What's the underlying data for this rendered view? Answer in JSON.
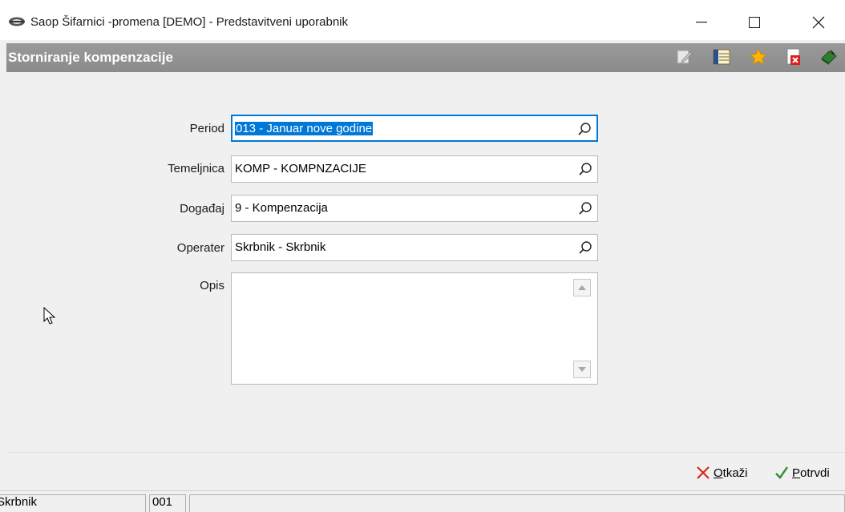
{
  "window": {
    "title": "Saop Šifarnici -promena [DEMO] - Predstavitveni uporabnik"
  },
  "header": {
    "title": "Storniranje kompenzacije",
    "icons": [
      "edit-icon",
      "columns-icon",
      "favorite-star-icon",
      "pdf-close-icon",
      "exit-book-icon"
    ]
  },
  "form": {
    "period": {
      "label": "Period",
      "value": "013 - Januar nove godine"
    },
    "temeljnica": {
      "label": "Temeljnica",
      "value": "KOMP - KOMPNZACIJE"
    },
    "dogadjaj": {
      "label": "Događaj",
      "value": "9 - Kompenzacija"
    },
    "operater": {
      "label": "Operater",
      "value": "Skrbnik - Skrbnik"
    },
    "opis": {
      "label": "Opis",
      "value": ""
    }
  },
  "buttons": {
    "cancel": {
      "accel": "O",
      "rest": "tkaži"
    },
    "confirm": {
      "accel": "P",
      "rest": "otrvdi"
    }
  },
  "statusbar": {
    "user": "Skrbnik",
    "code": "001",
    "message": ""
  },
  "colors": {
    "accent": "#0078d7",
    "header_bg": "#8e8e8e",
    "cancel": "#d9261c",
    "confirm": "#2e8b2e"
  }
}
